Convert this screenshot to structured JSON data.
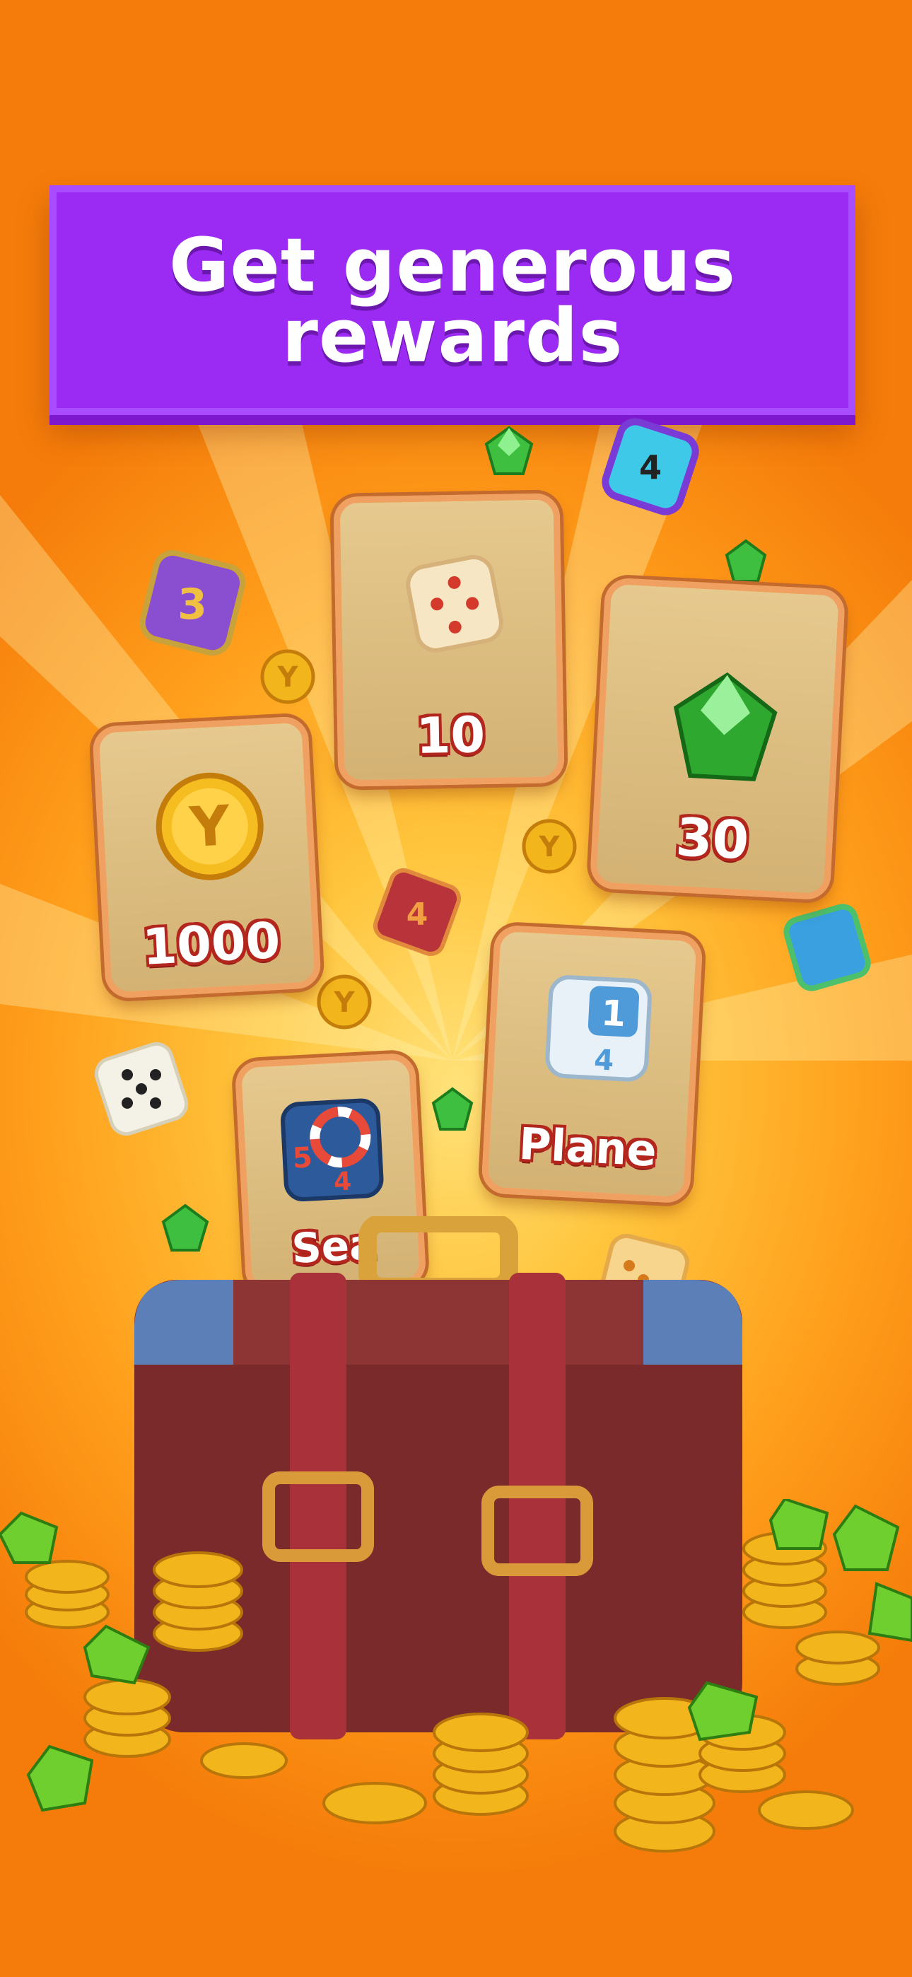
{
  "banner": {
    "title": "Get generous rewards"
  },
  "rewards": [
    {
      "label": "10",
      "icon": "dice-icon"
    },
    {
      "label": "30",
      "icon": "gem-icon"
    },
    {
      "label": "1000",
      "icon": "coin-icon"
    },
    {
      "label": "Plane",
      "icon": "plane-dice-icon"
    },
    {
      "label": "Sea",
      "icon": "sea-dice-icon"
    }
  ],
  "colors": {
    "background": "#ff9f1c",
    "banner": "#9b2bf2",
    "card": "#e0c285",
    "label_outline": "#b3261e",
    "suitcase": "#7a2a2a"
  }
}
